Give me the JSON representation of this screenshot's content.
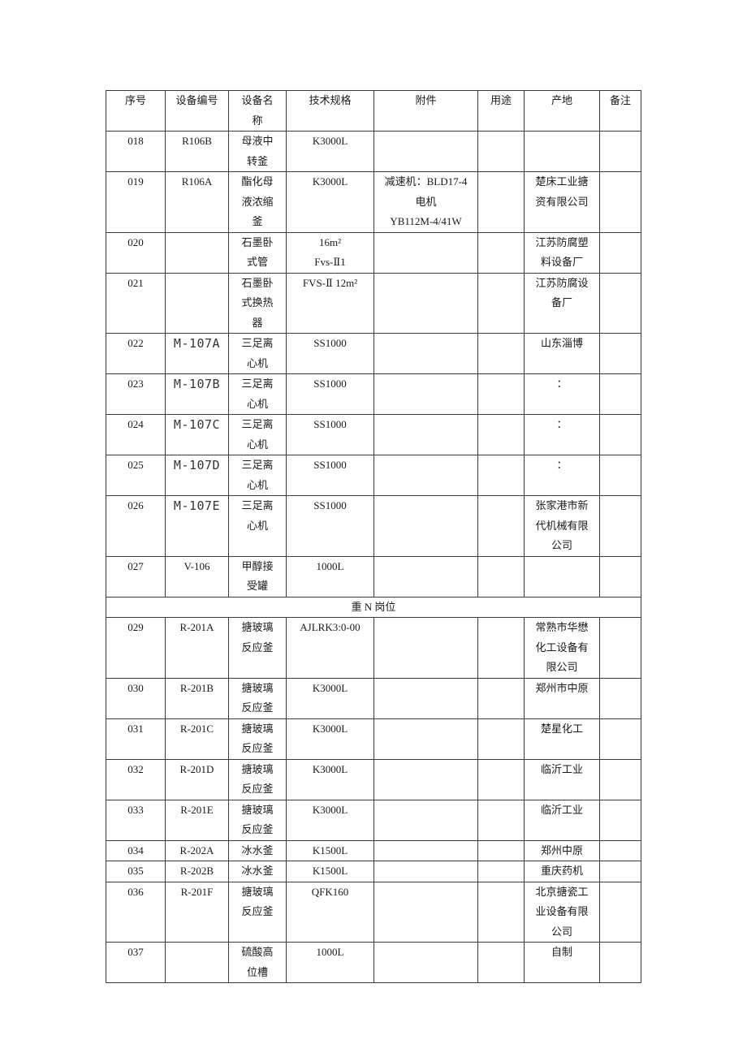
{
  "table": {
    "headers": [
      "序号",
      "设备编号",
      "设备名称",
      "技术规格",
      "附件",
      "用途",
      "产地",
      "备注"
    ],
    "rows_part1": [
      {
        "no": "018",
        "code": "R106B",
        "name": "母液中转釜",
        "spec": [
          "K3000L"
        ],
        "attach": [],
        "use": "",
        "origin": "",
        "note": ""
      },
      {
        "no": "019",
        "code": "R106A",
        "name": "酯化母液浓缩釜",
        "spec": [
          "K3000L"
        ],
        "attach": [
          "减速机：BLD17-4",
          "电机",
          "YB112M-4/41W"
        ],
        "use": "",
        "origin": "楚床工业搪资有限公司",
        "note": ""
      },
      {
        "no": "020",
        "code": "",
        "name": "石墨卧式管",
        "spec": [
          "16m²",
          "Fvs-Ⅱ1"
        ],
        "attach": [],
        "use": "",
        "origin": "江苏防腐塑料设备厂",
        "note": ""
      },
      {
        "no": "021",
        "code": "",
        "name": "石墨卧式换热器",
        "spec": [
          "FVS-Ⅱ  12m²"
        ],
        "attach": [],
        "use": "",
        "origin": "江苏防腐设备厂",
        "note": ""
      },
      {
        "no": "022",
        "code": "M-107A",
        "name": "三足离心机",
        "spec": [
          "SS1000"
        ],
        "attach": [],
        "use": "",
        "origin": "山东淄博",
        "note": ""
      },
      {
        "no": "023",
        "code": "M-107B",
        "name": "三足离心机",
        "spec": [
          "SS1000"
        ],
        "attach": [],
        "use": "",
        "origin": "：",
        "note": ""
      },
      {
        "no": "024",
        "code": "M-107C",
        "name": "三足离心机",
        "spec": [
          "SS1000"
        ],
        "attach": [],
        "use": "",
        "origin": "：",
        "note": ""
      },
      {
        "no": "025",
        "code": "M-107D",
        "name": "三足离心机",
        "spec": [
          "SS1000"
        ],
        "attach": [],
        "use": "",
        "origin": "：",
        "note": ""
      },
      {
        "no": "026",
        "code": "M-107E",
        "name": "三足离心机",
        "spec": [
          "SS1000"
        ],
        "attach": [],
        "use": "",
        "origin": "张家港市新代机械有限公司",
        "note": ""
      },
      {
        "no": "027",
        "code": "V-106",
        "name": "甲醇接受罐",
        "spec": [
          "1000L"
        ],
        "attach": [],
        "use": "",
        "origin": "",
        "note": ""
      }
    ],
    "section_label": "重 N 岗位",
    "rows_part2": [
      {
        "no": "029",
        "code": "R-201A",
        "name": "搪玻璃反应釜",
        "spec": [
          "AJLRK3:0-00"
        ],
        "attach": [],
        "use": "",
        "origin": "常熟市华懋化工设备有限公司",
        "note": ""
      },
      {
        "no": "030",
        "code": "R-201B",
        "name": "搪玻璃反应釜",
        "spec": [
          "K3000L"
        ],
        "attach": [],
        "use": "",
        "origin": "郑州市中原",
        "note": ""
      },
      {
        "no": "031",
        "code": "R-201C",
        "name": "搪玻璃反应釜",
        "spec": [
          "K3000L"
        ],
        "attach": [],
        "use": "",
        "origin": "楚星化工",
        "note": ""
      },
      {
        "no": "032",
        "code": "R-201D",
        "name": "搪玻璃反应釜",
        "spec": [
          "K3000L"
        ],
        "attach": [],
        "use": "",
        "origin": "临沂工业",
        "note": ""
      },
      {
        "no": "033",
        "code": "R-201E",
        "name": "搪玻璃反应釜",
        "spec": [
          "K3000L"
        ],
        "attach": [],
        "use": "",
        "origin": "临沂工业",
        "note": ""
      },
      {
        "no": "034",
        "code": "R-202A",
        "name": "冰水釜",
        "spec": [
          "K1500L"
        ],
        "attach": [],
        "use": "",
        "origin": "郑州中原",
        "note": ""
      },
      {
        "no": "035",
        "code": "R-202B",
        "name": "冰水釜",
        "spec": [
          "K1500L"
        ],
        "attach": [],
        "use": "",
        "origin": "重庆药机",
        "note": ""
      },
      {
        "no": "036",
        "code": "R-201F",
        "name": "搪玻璃反应釜",
        "spec": [
          "QFK160"
        ],
        "attach": [],
        "use": "",
        "origin": "北京搪瓷工业设备有限公司",
        "note": ""
      },
      {
        "no": "037",
        "code": "",
        "name": "硫酸高位槽",
        "spec": [
          "1000L"
        ],
        "attach": [],
        "use": "",
        "origin": "自制",
        "note": ""
      }
    ]
  }
}
